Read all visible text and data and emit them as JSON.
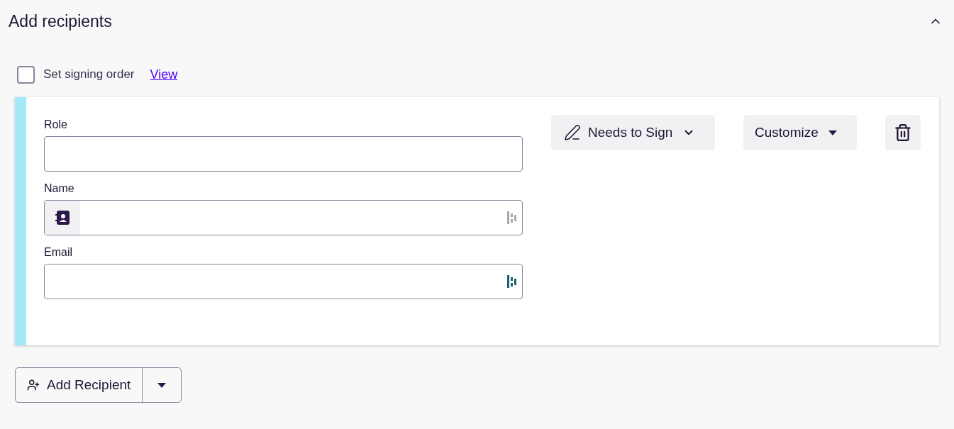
{
  "section": {
    "title": "Add recipients",
    "expanded": true
  },
  "signing_order": {
    "label": "Set signing order",
    "checked": false,
    "link": "View"
  },
  "recipient": {
    "fields": [
      {
        "label": "Role",
        "kind": "plain"
      },
      {
        "label": "Name",
        "kind": "contact"
      },
      {
        "label": "Email",
        "kind": "plain"
      }
    ],
    "action": "Needs to Sign",
    "customize": "Customize"
  },
  "add_button": {
    "label": "Add Recipient"
  }
}
